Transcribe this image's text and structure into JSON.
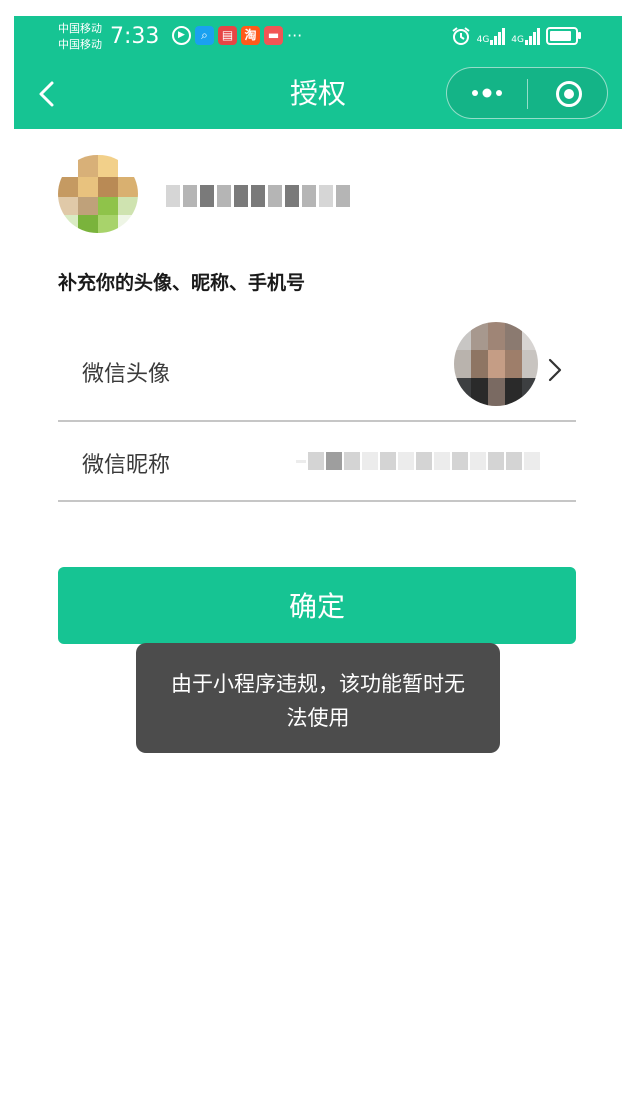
{
  "status_bar": {
    "carrier_1": "中国移动",
    "carrier_2": "中国移动",
    "time": "7:33",
    "notification_icons": [
      "video-play-icon",
      "search-app-icon",
      "book-app-icon",
      "taobao-app-icon",
      "red-app-icon",
      "more-dots-icon"
    ],
    "taobao_glyph": "淘",
    "more_glyph": "···",
    "network_1": "4G",
    "network_2": "4G",
    "icons_right": [
      "alarm-icon",
      "signal-4g-icon",
      "signal-4g-icon",
      "battery-icon"
    ]
  },
  "nav": {
    "title": "授权",
    "back_icon": "chevron-left-icon",
    "capsule_icons": [
      "more-dots-icon",
      "target-circle-icon"
    ]
  },
  "profile": {
    "logo_icon": "app-logo-pixelated",
    "name_redacted": true
  },
  "form": {
    "section_title": "补充你的头像、昵称、手机号",
    "avatar_label": "微信头像",
    "nickname_label": "微信昵称",
    "nickname_redacted": true
  },
  "actions": {
    "confirm_label": "确定"
  },
  "toast": {
    "message": "由于小程序违规，该功能暂时无法使用"
  },
  "colors": {
    "brand_green": "#16c493",
    "toast_bg": "#4c4c4c",
    "divider": "#c6c6c6"
  }
}
